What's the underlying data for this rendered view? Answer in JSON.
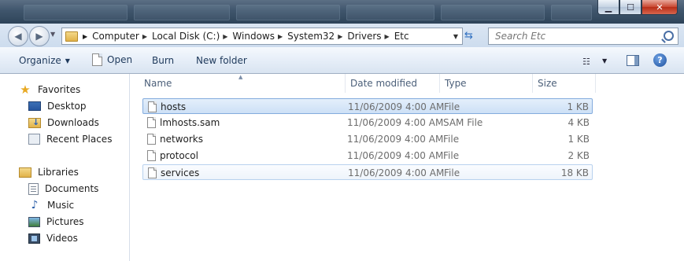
{
  "window": {
    "buttons": {
      "minimize": "▁",
      "maximize": "☐",
      "close": "✕"
    }
  },
  "address": {
    "crumbs": [
      "Computer",
      "Local Disk (C:)",
      "Windows",
      "System32",
      "Drivers",
      "Etc"
    ]
  },
  "search": {
    "placeholder": "Search Etc"
  },
  "toolbar": {
    "organize": "Organize",
    "open": "Open",
    "burn": "Burn",
    "new_folder": "New folder"
  },
  "navigation": {
    "favorites": {
      "label": "Favorites",
      "items": [
        "Desktop",
        "Downloads",
        "Recent Places"
      ]
    },
    "libraries": {
      "label": "Libraries",
      "items": [
        "Documents",
        "Music",
        "Pictures",
        "Videos"
      ]
    }
  },
  "columns": {
    "name": "Name",
    "date": "Date modified",
    "type": "Type",
    "size": "Size"
  },
  "files": [
    {
      "name": "hosts",
      "date": "11/06/2009 4:00 AM",
      "type": "File",
      "size": "1 KB",
      "state": "selected"
    },
    {
      "name": "lmhosts.sam",
      "date": "11/06/2009 4:00 AM",
      "type": "SAM File",
      "size": "4 KB",
      "state": ""
    },
    {
      "name": "networks",
      "date": "11/06/2009 4:00 AM",
      "type": "File",
      "size": "1 KB",
      "state": ""
    },
    {
      "name": "protocol",
      "date": "11/06/2009 4:00 AM",
      "type": "File",
      "size": "2 KB",
      "state": ""
    },
    {
      "name": "services",
      "date": "11/06/2009 4:00 AM",
      "type": "File",
      "size": "18 KB",
      "state": "hover"
    }
  ],
  "icons": {
    "back": "back-arrow-icon",
    "forward": "forward-arrow-icon",
    "refresh": "refresh-icon",
    "search": "magnifier-icon",
    "help": "help-icon",
    "views": "views-icon",
    "preview": "preview-pane-icon"
  },
  "colors": {
    "selection_border": "#84acdd",
    "selection_fill": "#cde0f6",
    "link_text": "#1e395b"
  }
}
